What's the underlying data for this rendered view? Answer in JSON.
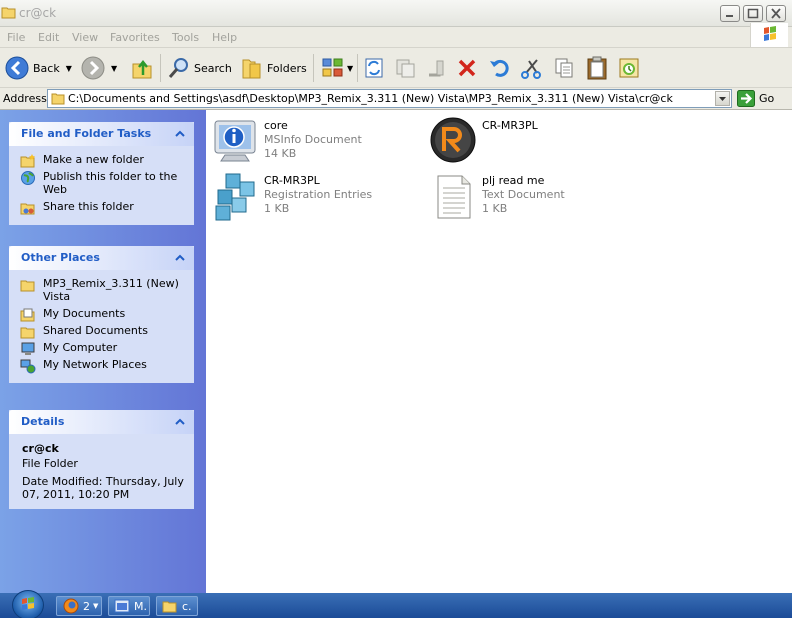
{
  "window": {
    "title": "cr@ck"
  },
  "menu": [
    "File",
    "Edit",
    "View",
    "Favorites",
    "Tools",
    "Help"
  ],
  "toolbar": {
    "back": "Back",
    "search": "Search",
    "folders": "Folders"
  },
  "address": {
    "label": "Address",
    "path": "C:\\Documents and Settings\\asdf\\Desktop\\MP3_Remix_3.311 (New) Vista\\MP3_Remix_3.311 (New) Vista\\cr@ck",
    "go": "Go"
  },
  "tasks_panel": {
    "title": "File and Folder Tasks",
    "items": [
      "Make a new folder",
      "Publish this folder to the Web",
      "Share this folder"
    ]
  },
  "places_panel": {
    "title": "Other Places",
    "items": [
      "MP3_Remix_3.311 (New) Vista",
      "My Documents",
      "Shared Documents",
      "My Computer",
      "My Network Places"
    ]
  },
  "details_panel": {
    "title": "Details",
    "name": "cr@ck",
    "type": "File Folder",
    "modified": "Date Modified: Thursday, July 07, 2011, 10:20 PM"
  },
  "files": [
    {
      "name": "core",
      "type": "MSInfo Document",
      "size": "14 KB",
      "icon": "msinfo-icon"
    },
    {
      "name": "CR-MR3PL",
      "type": "",
      "size": "",
      "icon": "app-r-icon"
    },
    {
      "name": "CR-MR3PL",
      "type": "Registration Entries",
      "size": "1 KB",
      "icon": "registry-icon"
    },
    {
      "name": "plj read me",
      "type": "Text Document",
      "size": "1 KB",
      "icon": "text-document-icon"
    }
  ],
  "taskbar": {
    "items": [
      "2",
      "M.",
      "c."
    ]
  },
  "colors": {
    "taskpane_blue": "#6375d6",
    "panel_title": "#215dc6",
    "taskbar": "#1b4b97"
  }
}
